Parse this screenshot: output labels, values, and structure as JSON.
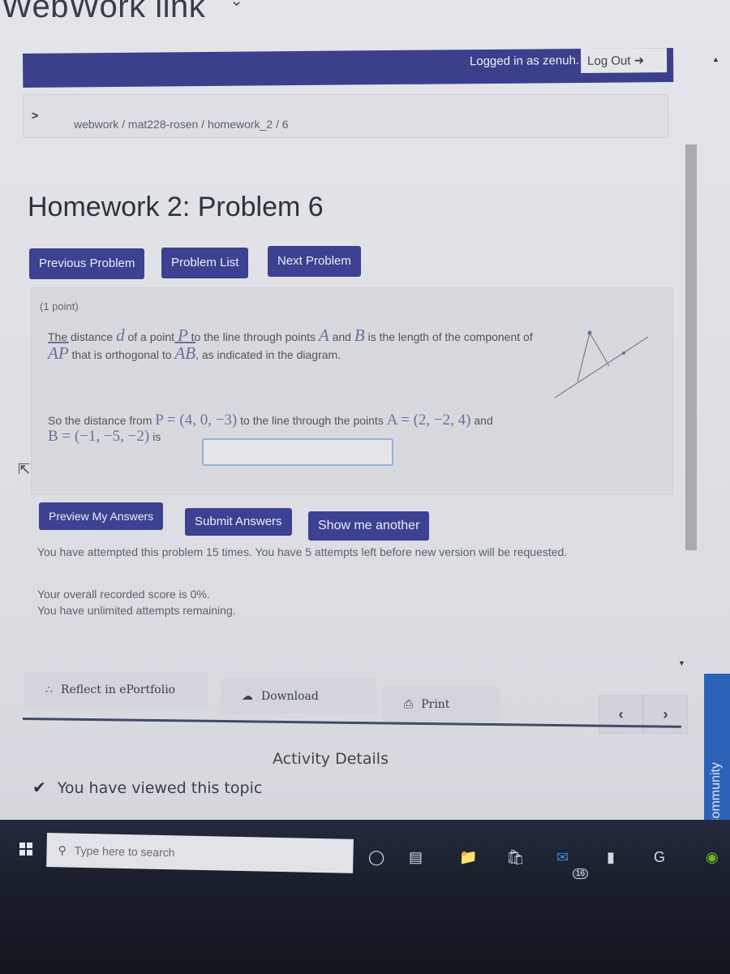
{
  "browser": {
    "tab_title": "WebWork link"
  },
  "header": {
    "logged_in_text": "Logged in as zenuh.",
    "logout_label": "Log Out",
    "logout_icon": "sign-out-icon"
  },
  "breadcrumb": {
    "toggle_icon": "chevron-right-icon",
    "path": "webwork / mat228-rosen / homework_2 / 6"
  },
  "page": {
    "title": "Homework 2: Problem 6"
  },
  "nav_buttons": {
    "previous": "Previous Problem",
    "list": "Problem List",
    "next": "Next Problem"
  },
  "problem": {
    "points": "(1 point)",
    "intro": {
      "t1": "The distance ",
      "d": "d",
      "t2": " of a point ",
      "P": "P",
      "t3": " to the line through points ",
      "A": "A",
      "t4": " and ",
      "B": "B",
      "t5": " is the length of the component of ",
      "AP": "AP",
      "t6": " that is orthogonal to ",
      "AB": "AB",
      "t7": ", as indicated in the diagram."
    },
    "question": {
      "t1": "So the distance from ",
      "P_def": "P = (4, 0, −3)",
      "t2": " to the line through the points ",
      "A_def": "A = (2, −2, 4)",
      "t3": " and",
      "B_def": "B = (−1, −5, −2)",
      "t4": " is"
    },
    "answer_value": "",
    "diagram_icon": "triangle-diagram"
  },
  "action_buttons": {
    "preview": "Preview My Answers",
    "submit": "Submit Answers",
    "another": "Show me another"
  },
  "status": {
    "line1": "You have attempted this problem 15 times. You have 5 attempts left before new version will be requested.",
    "line2": "Your overall recorded score is 0%.",
    "line3": "You have unlimited attempts remaining."
  },
  "lms_toolbar": {
    "reflect": "Reflect in ePortfolio",
    "download": "Download",
    "print": "Print",
    "prev_icon": "chevron-left-icon",
    "next_icon": "chevron-right-icon"
  },
  "activity": {
    "title": "Activity Details",
    "viewed": "You have viewed this topic"
  },
  "sidebar_tab": {
    "label": "Community"
  },
  "taskbar": {
    "search_placeholder": "Type here to search",
    "mail_badge": "16"
  },
  "colors": {
    "brand_navy": "#3b3f8c",
    "button": "#3d4192",
    "math": "#6a6f9a",
    "taskbar": "#1a1f2c",
    "community_tab": "#2d62b9"
  }
}
